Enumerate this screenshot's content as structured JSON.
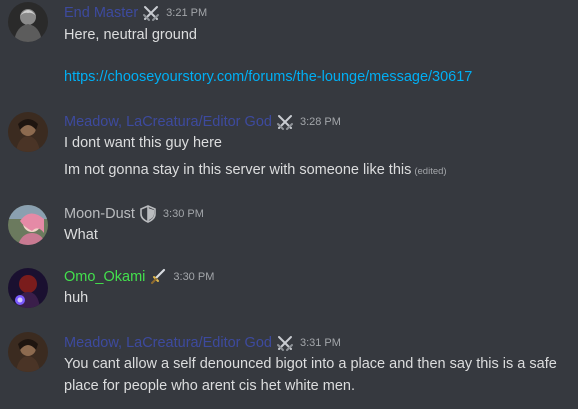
{
  "colors": {
    "background": "#36393f",
    "text": "#dcddde",
    "muted": "#a3a6aa",
    "link": "#00aff4",
    "role_blue": "#3d4a9e",
    "role_gray": "#b9bbbe",
    "role_green": "#43e04d"
  },
  "messages": [
    {
      "author": "End Master",
      "author_color": "#3d4a9e",
      "badge": "crossed-swords-icon",
      "time": "3:21 PM",
      "lines": [
        "Here, neutral ground"
      ],
      "link": "https://chooseyourstory.com/forums/the-lounge/message/30617"
    },
    {
      "author": "Meadow, LaCreatura/Editor God",
      "author_color": "#3d4a9e",
      "badge": "crossed-swords-icon",
      "time": "3:28 PM",
      "lines": [
        "I dont want this guy here",
        "Im not gonna stay in this server with someone like this"
      ],
      "edited": "(edited)"
    },
    {
      "author": "Moon-Dust",
      "author_color": "#b9bbbe",
      "badge": "shield-icon",
      "time": "3:30 PM",
      "lines": [
        "What"
      ]
    },
    {
      "author": "Omo_Okami",
      "author_color": "#43e04d",
      "badge": "dagger-icon",
      "time": "3:30 PM",
      "lines": [
        "huh"
      ]
    },
    {
      "author": "Meadow, LaCreatura/Editor God",
      "author_color": "#3d4a9e",
      "badge": "crossed-swords-icon",
      "time": "3:31 PM",
      "lines": [
        "You cant allow a self denounced bigot into a place and then say this is a safe place for people who arent cis het white men."
      ]
    }
  ]
}
